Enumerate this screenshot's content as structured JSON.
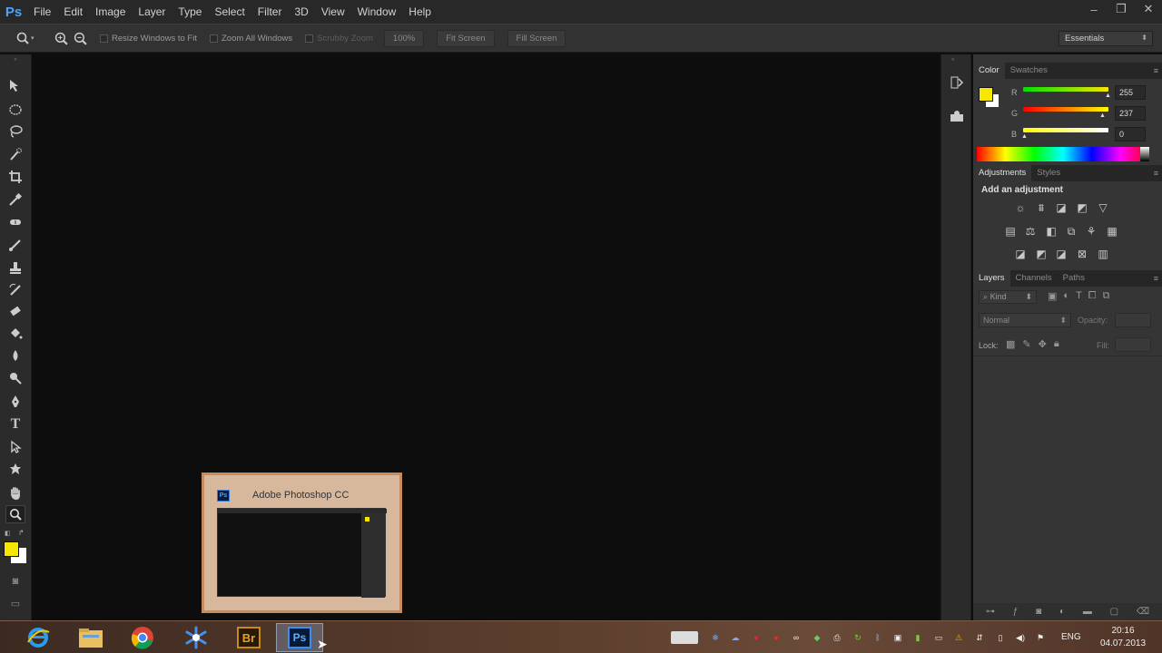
{
  "app": {
    "logo": "Ps"
  },
  "menu": [
    "File",
    "Edit",
    "Image",
    "Layer",
    "Type",
    "Select",
    "Filter",
    "3D",
    "View",
    "Window",
    "Help"
  ],
  "window_controls": {
    "minimize": "–",
    "restore": "❐",
    "close": "✕"
  },
  "options": {
    "resize_windows": "Resize Windows to Fit",
    "zoom_all": "Zoom All Windows",
    "scrubby_zoom": "Scrubby Zoom",
    "zoom_pct": "100%",
    "fit_screen": "Fit Screen",
    "fill_screen": "Fill Screen",
    "workspace": "Essentials"
  },
  "color_panel": {
    "tabs": [
      "Color",
      "Swatches"
    ],
    "channels": [
      {
        "label": "R",
        "value": "255"
      },
      {
        "label": "G",
        "value": "237"
      },
      {
        "label": "B",
        "value": "0"
      }
    ],
    "foreground": "#f7e600",
    "background": "#ffffff"
  },
  "adjustments_panel": {
    "tabs": [
      "Adjustments",
      "Styles"
    ],
    "heading": "Add an adjustment"
  },
  "layers_panel": {
    "tabs": [
      "Layers",
      "Channels",
      "Paths"
    ],
    "filter_kind": "Kind",
    "blend_mode": "Normal",
    "opacity_label": "Opacity:",
    "lock_label": "Lock:",
    "fill_label": "Fill:"
  },
  "taskbar_preview": {
    "title": "Adobe Photoshop CC"
  },
  "taskbar": {
    "bridge_label": "Br",
    "photoshop_label": "Ps",
    "language": "ENG",
    "time": "20:16",
    "date": "04.07.2013"
  }
}
